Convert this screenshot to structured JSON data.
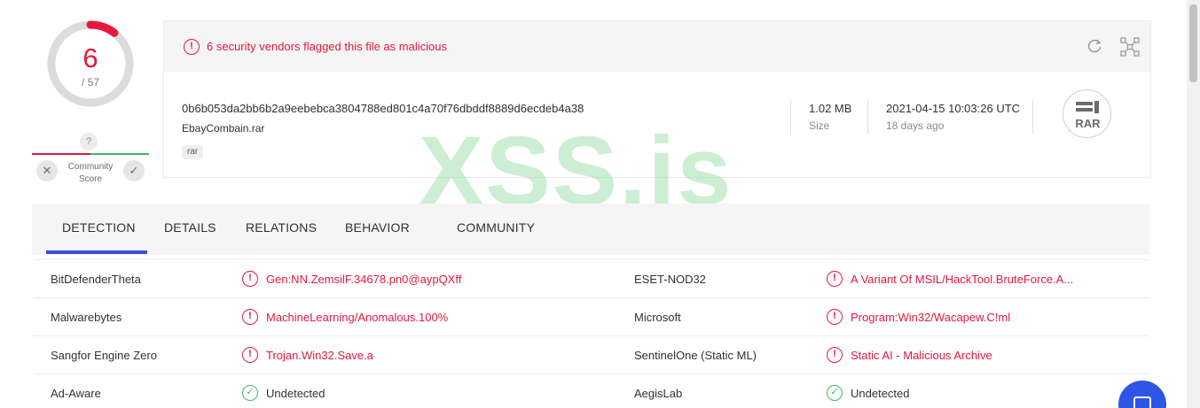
{
  "score": {
    "detected": "6",
    "total": "/ 57",
    "fraction": 0.105,
    "ring_color": "#e8173d"
  },
  "community": {
    "unknown_glyph": "?",
    "label_line1": "Community",
    "label_line2": "Score",
    "down_glyph": "✕",
    "up_glyph": "✓"
  },
  "alert": {
    "text": "6 security vendors flagged this file as malicious",
    "icon": "alert-circle-icon",
    "color": "#e8173d"
  },
  "file": {
    "hash": "0b6b053da2bb6b2a9eebebca3804788ed801c4a70f76dbddf8889d6ecdeb4a38",
    "name": "EbayCombain.rar",
    "tag": "rar",
    "size_value": "1.02 MB",
    "size_label": "Size",
    "date_value": "2021-04-15 10:03:26 UTC",
    "date_relative": "18 days ago",
    "type_label": "RAR"
  },
  "toolbar": {
    "reanalyze_icon": "refresh-icon",
    "similar_icon": "graph-icon"
  },
  "watermark": "XSS.is",
  "tabs": [
    {
      "label": "DETECTION",
      "active": true
    },
    {
      "label": "DETAILS",
      "active": false
    },
    {
      "label": "RELATIONS",
      "active": false
    },
    {
      "label": "BEHAVIOR",
      "active": false
    },
    {
      "label": "COMMUNITY",
      "active": false
    }
  ],
  "detections": [
    {
      "left": {
        "engine": "BitDefenderTheta",
        "result": "Gen:NN.ZemsilF.34678.pn0@aypQXff",
        "status": "malicious"
      },
      "right": {
        "engine": "ESET-NOD32",
        "result": "A Variant Of MSIL/HackTool.BruteForce.A...",
        "status": "malicious"
      }
    },
    {
      "left": {
        "engine": "Malwarebytes",
        "result": "MachineLearning/Anomalous.100%",
        "status": "malicious"
      },
      "right": {
        "engine": "Microsoft",
        "result": "Program:Win32/Wacapew.C!ml",
        "status": "malicious"
      }
    },
    {
      "left": {
        "engine": "Sangfor Engine Zero",
        "result": "Trojan.Win32.Save.a",
        "status": "malicious"
      },
      "right": {
        "engine": "SentinelOne (Static ML)",
        "result": "Static AI - Malicious Archive",
        "status": "malicious"
      }
    },
    {
      "left": {
        "engine": "Ad-Aware",
        "result": "Undetected",
        "status": "undetected"
      },
      "right": {
        "engine": "AegisLab",
        "result": "Undetected",
        "status": "undetected"
      }
    }
  ],
  "colors": {
    "malicious": "#e8173d",
    "undetected": "#3fb868",
    "accent": "#3a4fe0",
    "fab": "#2f55e5"
  }
}
